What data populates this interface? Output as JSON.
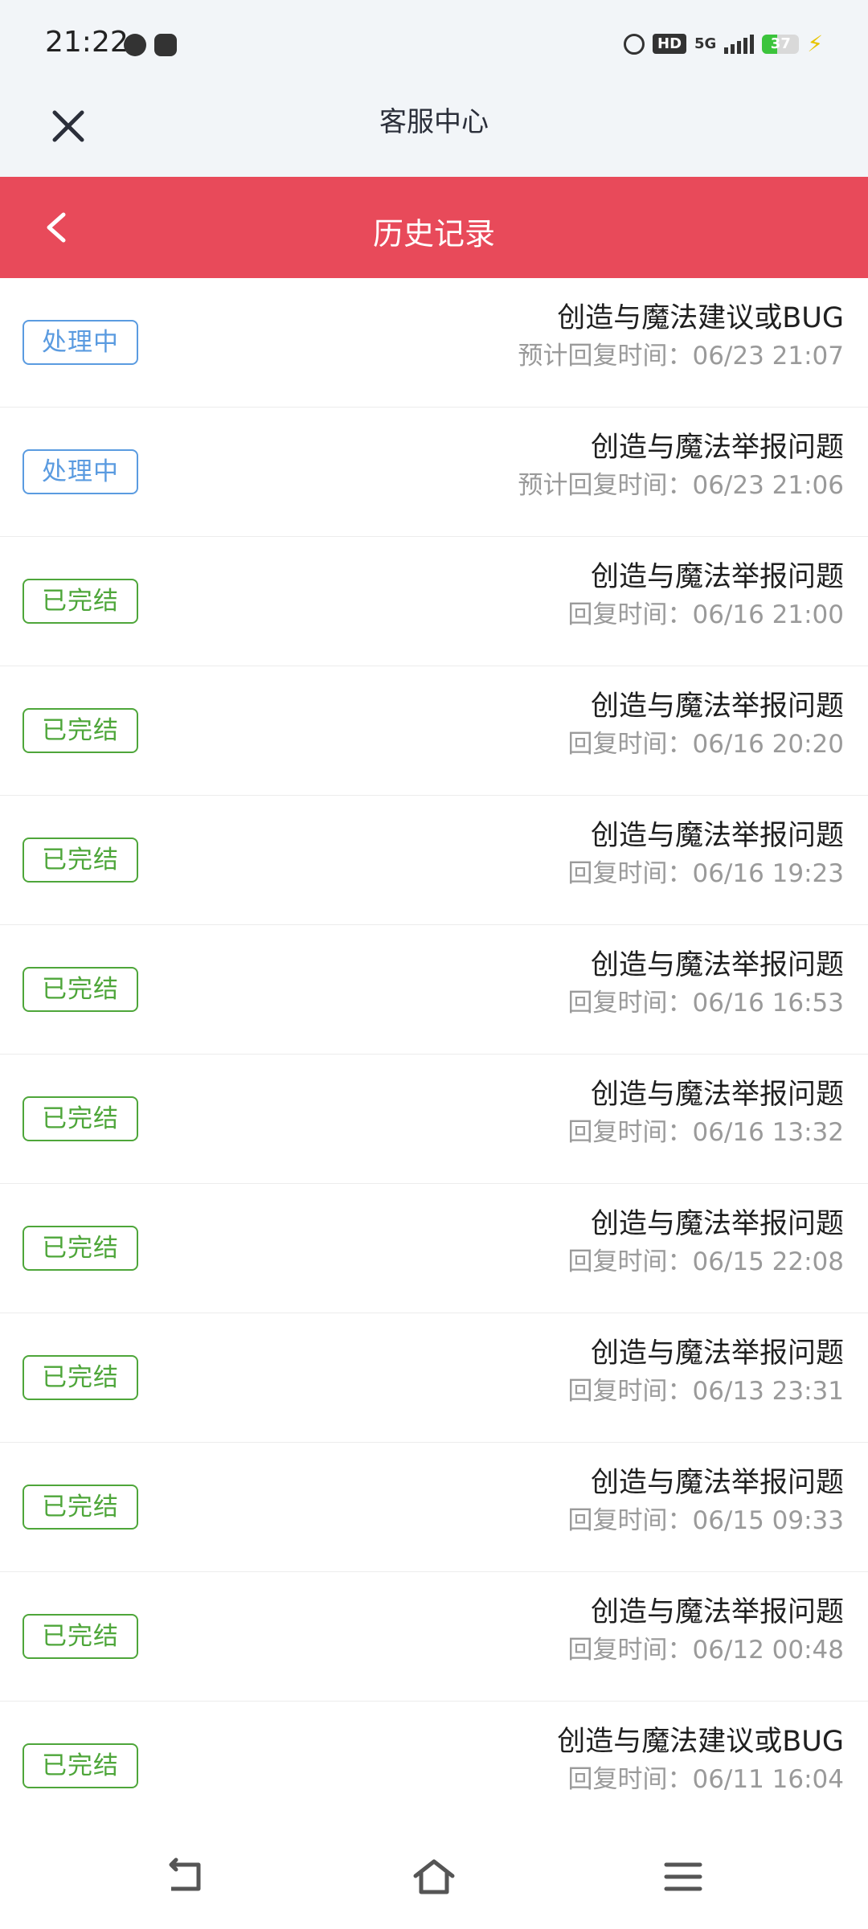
{
  "status_bar": {
    "time": "21:22",
    "left_icons": [
      "message-icon",
      "app-notification-icon"
    ],
    "right_icons": [
      "alarm-icon",
      "hd-icon",
      "5g-signal-icon",
      "battery-icon",
      "charging-icon"
    ],
    "hd_label": "HD",
    "network_label": "5G",
    "battery_level": "37"
  },
  "header": {
    "title": "客服中心",
    "close_icon": "close-icon"
  },
  "history_header": {
    "title": "历史记录",
    "back_icon": "chevron-left-icon"
  },
  "colors": {
    "accent_red": "#e84a5a",
    "status_processing": "#5a9be0",
    "status_done": "#4ea63a",
    "text_secondary": "#9a9a9a"
  },
  "records": [
    {
      "status": "处理中",
      "status_type": "processing",
      "title": "创造与魔法建议或BUG",
      "time": "预计回复时间：06/23 21:07"
    },
    {
      "status": "处理中",
      "status_type": "processing",
      "title": "创造与魔法举报问题",
      "time": "预计回复时间：06/23 21:06"
    },
    {
      "status": "已完结",
      "status_type": "done",
      "title": "创造与魔法举报问题",
      "time": "回复时间：06/16 21:00"
    },
    {
      "status": "已完结",
      "status_type": "done",
      "title": "创造与魔法举报问题",
      "time": "回复时间：06/16 20:20"
    },
    {
      "status": "已完结",
      "status_type": "done",
      "title": "创造与魔法举报问题",
      "time": "回复时间：06/16 19:23"
    },
    {
      "status": "已完结",
      "status_type": "done",
      "title": "创造与魔法举报问题",
      "time": "回复时间：06/16 16:53"
    },
    {
      "status": "已完结",
      "status_type": "done",
      "title": "创造与魔法举报问题",
      "time": "回复时间：06/16 13:32"
    },
    {
      "status": "已完结",
      "status_type": "done",
      "title": "创造与魔法举报问题",
      "time": "回复时间：06/15 22:08"
    },
    {
      "status": "已完结",
      "status_type": "done",
      "title": "创造与魔法举报问题",
      "time": "回复时间：06/13 23:31"
    },
    {
      "status": "已完结",
      "status_type": "done",
      "title": "创造与魔法举报问题",
      "time": "回复时间：06/15 09:33"
    },
    {
      "status": "已完结",
      "status_type": "done",
      "title": "创造与魔法举报问题",
      "time": "回复时间：06/12 00:48"
    },
    {
      "status": "已完结",
      "status_type": "done",
      "title": "创造与魔法建议或BUG",
      "time": "回复时间：06/11 16:04"
    }
  ],
  "nav_bar": {
    "items": [
      "back-nav-icon",
      "home-icon",
      "menu-icon"
    ]
  }
}
